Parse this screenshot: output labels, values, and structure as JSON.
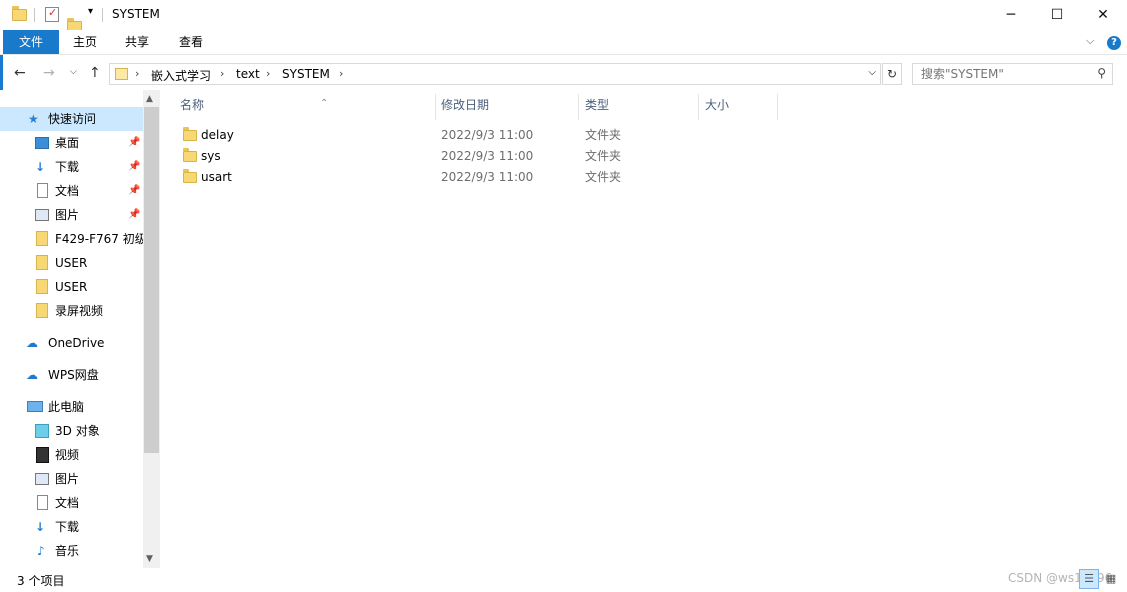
{
  "window": {
    "title": "SYSTEM",
    "controls": {
      "minimize": "─",
      "maximize": "☐",
      "close": "✕"
    }
  },
  "ribbon": {
    "tabs": [
      {
        "label": "文件",
        "active": true
      },
      {
        "label": "主页"
      },
      {
        "label": "共享"
      },
      {
        "label": "查看"
      }
    ],
    "help": "?"
  },
  "address": {
    "crumbs": [
      "嵌入式学习",
      "text",
      "SYSTEM"
    ]
  },
  "search": {
    "placeholder": "搜索\"SYSTEM\""
  },
  "sidebar": {
    "quick_access": "快速访问",
    "items": [
      {
        "label": "桌面",
        "icon": "desktop-icon",
        "pinned": true
      },
      {
        "label": "下载",
        "icon": "download-icon",
        "pinned": true
      },
      {
        "label": "文档",
        "icon": "document-icon",
        "pinned": true
      },
      {
        "label": "图片",
        "icon": "picture-icon",
        "pinned": true
      },
      {
        "label": "F429-F767 初级",
        "icon": "folder-icon"
      },
      {
        "label": "USER",
        "icon": "folder-icon"
      },
      {
        "label": "USER",
        "icon": "folder-icon"
      },
      {
        "label": "录屏视频",
        "icon": "folder-icon"
      }
    ],
    "onedrive": "OneDrive",
    "wps": "WPS网盘",
    "this_pc": "此电脑",
    "pc_items": [
      {
        "label": "3D 对象",
        "icon": "cube-icon"
      },
      {
        "label": "视频",
        "icon": "video-icon"
      },
      {
        "label": "图片",
        "icon": "picture-icon"
      },
      {
        "label": "文档",
        "icon": "document-icon"
      },
      {
        "label": "下载",
        "icon": "download-icon"
      },
      {
        "label": "音乐",
        "icon": "music-icon"
      }
    ]
  },
  "columns": [
    "名称",
    "修改日期",
    "类型",
    "大小"
  ],
  "files": [
    {
      "name": "delay",
      "date": "2022/9/3 11:00",
      "type": "文件夹"
    },
    {
      "name": "sys",
      "date": "2022/9/3 11:00",
      "type": "文件夹"
    },
    {
      "name": "usart",
      "date": "2022/9/3 11:00",
      "type": "文件夹"
    }
  ],
  "status": {
    "count": "3 个项目",
    "watermark": "CSDN @ws15996"
  },
  "colors": {
    "accent": "#1979ca",
    "selection": "#cce8ff",
    "folder": "#f8d775"
  }
}
